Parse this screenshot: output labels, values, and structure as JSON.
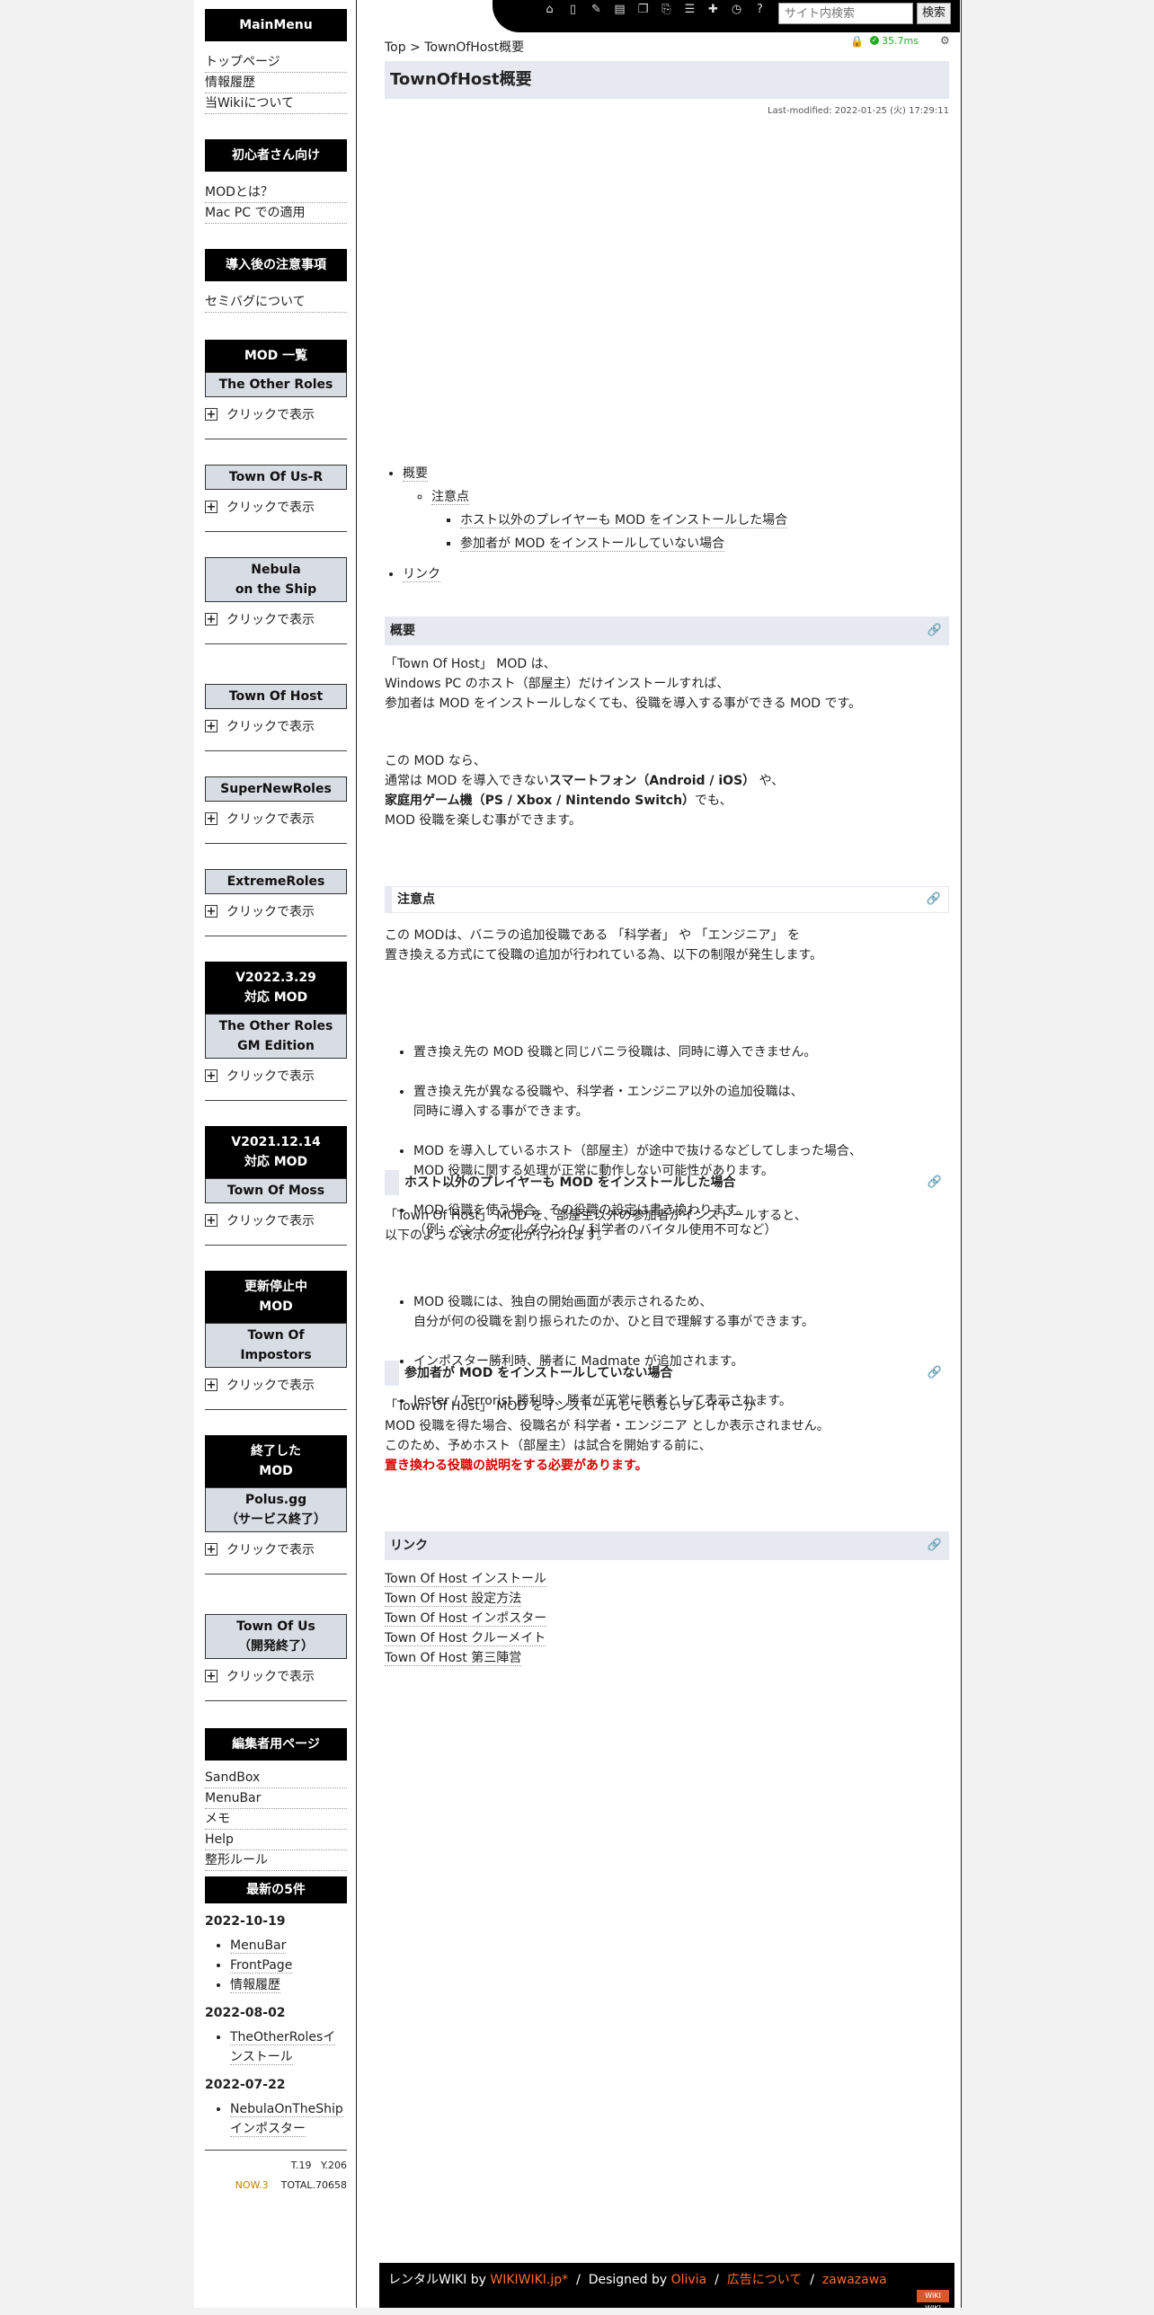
{
  "header": {
    "search_placeholder": "サイト内検索",
    "search_button": "検索",
    "icons": [
      "home-icon",
      "page-icon",
      "edit-icon",
      "diff-icon",
      "copy-icon",
      "attach-icon",
      "list-icon",
      "new-icon",
      "recent-icon",
      "help-icon"
    ]
  },
  "status": {
    "ms": "35.7ms"
  },
  "breadcrumb": {
    "top": "Top",
    "sep": ">",
    "current": "TownOfHost概要"
  },
  "page": {
    "title": "TownOfHost概要",
    "last_modified": "Last-modified: 2022-01-25 (火) 17:29:11"
  },
  "sidebar": {
    "mainmenu": {
      "title": "MainMenu",
      "links": [
        "トップページ",
        "情報履歴",
        "当Wikiについて"
      ]
    },
    "beginner": {
      "title": "初心者さん向け",
      "links": [
        "MODとは？",
        "Mac PC での適用"
      ]
    },
    "notice": {
      "title": "導入後の注意事項",
      "links": [
        "セミバグについて"
      ]
    },
    "modlist_title": "MOD 一覧",
    "toggle_label": "クリックで表示",
    "mods1": [
      "The Other Roles",
      "Town Of Us-R",
      "Nebula\non the Ship",
      "Town Of Host",
      "SuperNewRoles",
      "ExtremeRoles"
    ],
    "v2022_title": "V2022.3.29\n対応 MOD",
    "v2022_mod": "The Other Roles\nGM Edition",
    "v2021_title": "V2021.12.14\n対応 MOD",
    "v2021_mod": "Town Of Moss",
    "stopped_title": "更新停止中\nMOD",
    "stopped_mod": "Town Of\nImpostors",
    "ended_title": "終了した\nMOD",
    "ended_mod": "Polus.gg\n（サービス終了）",
    "tou_mod": "Town Of Us\n（開発終了）",
    "editor": {
      "title": "編集者用ページ",
      "links": [
        "SandBox",
        "MenuBar",
        "メモ",
        "Help",
        "整形ルール"
      ]
    },
    "recent": {
      "title": "最新の5件",
      "groups": [
        {
          "date": "2022-10-19",
          "items": [
            "MenuBar",
            "FrontPage",
            "情報履歴"
          ]
        },
        {
          "date": "2022-08-02",
          "items": [
            "TheOtherRolesインストール"
          ]
        },
        {
          "date": "2022-07-22",
          "items": [
            "NebulaOnTheShipインポスター"
          ]
        }
      ]
    },
    "counter": {
      "today": "T.19",
      "yesterday": "Y.206",
      "now": "NOW.3",
      "total": "TOTAL.70658"
    }
  },
  "toc": {
    "overview": "概要",
    "notes": "注意点",
    "case1": "ホスト以外のプレイヤーも MOD をインストールした場合",
    "case2": "参加者が MOD をインストールしていない場合",
    "links": "リンク"
  },
  "sections": {
    "overview": {
      "heading": "概要",
      "p1": [
        "「Town Of Host」 MOD は、",
        "Windows PC のホスト（部屋主）だけインストールすれば、",
        "参加者は MOD をインストールしなくても、役職を導入する事ができる MOD です。"
      ],
      "p2_line1": "この MOD なら、",
      "p2_line2a": "通常は MOD を導入できない",
      "p2_line2b": "スマートフォン（Android / iOS）",
      "p2_line2c": " や、",
      "p2_line3a": "家庭用ゲーム機（PS / Xbox / Nintendo Switch）",
      "p2_line3b": "でも、",
      "p2_line4": "MOD 役職を楽しむ事ができます。"
    },
    "notes": {
      "heading": "注意点",
      "p1": [
        "この MODは、バニラの追加役職である 「科学者」 や 「エンジニア」 を",
        "置き換える方式にて役職の追加が行われている為、以下の制限が発生します。"
      ],
      "bullets": [
        "置き換え先の MOD 役職と同じバニラ役職は、同時に導入できません。",
        "置き換え先が異なる役職や、科学者・エンジニア以外の追加役職は、\n同時に導入する事ができます。",
        "MOD を導入しているホスト（部屋主）が途中で抜けるなどしてしまった場合、\nMOD 役職に関する処理が正常に動作しない可能性があります。",
        "MOD 役職を使う場合、その役職の設定は書き換わります。\n（例：ベントクールダウン 0 / 科学者のバイタル使用不可など）"
      ]
    },
    "case1": {
      "heading": "ホスト以外のプレイヤーも MOD をインストールした場合",
      "p1": [
        "「Town Of Host」 MOD を、部屋主以外の参加者がインストールすると、",
        "以下のような表示の変化が行われます。"
      ],
      "bullets": [
        "MOD 役職には、独自の開始画面が表示されるため、\n自分が何の役職を割り振られたのか、ひと目で理解する事ができます。",
        "インポスター勝利時、勝者に Madmate が追加されます。",
        "Jester / Terrorist 勝利時、勝者が正常に勝者として表示されます。"
      ]
    },
    "case2": {
      "heading": "参加者が MOD をインストールしていない場合",
      "p1": [
        "「Town Of Host」 MOD をインストールしていないプレイヤーが",
        "MOD 役職を得た場合、役職名が 科学者・エンジニア としか表示されません。",
        "このため、予めホスト（部屋主）は試合を開始する前に、"
      ],
      "red": "置き換わる役職の説明をする必要があります。"
    },
    "links": {
      "heading": "リンク",
      "items": [
        "Town Of Host インストール",
        "Town Of Host 設定方法",
        "Town Of Host インポスター",
        "Town Of Host クルーメイト",
        "Town Of Host 第三陣営"
      ]
    }
  },
  "footer": {
    "rental": "レンタルWIKI by ",
    "wikiwiki": "WIKIWIKI.jp*",
    "designed": "Designed by ",
    "olivia": "Olivia",
    "ads": "広告について",
    "zawazawa": "zawazawa",
    "sep": "/",
    "badge": "WIKI WIKI"
  },
  "colors": {
    "accent_link": "#ff6a2a",
    "heading_bg": "#e6e9f0",
    "red_text": "#dd0000",
    "ok_green": "#22aa22"
  }
}
